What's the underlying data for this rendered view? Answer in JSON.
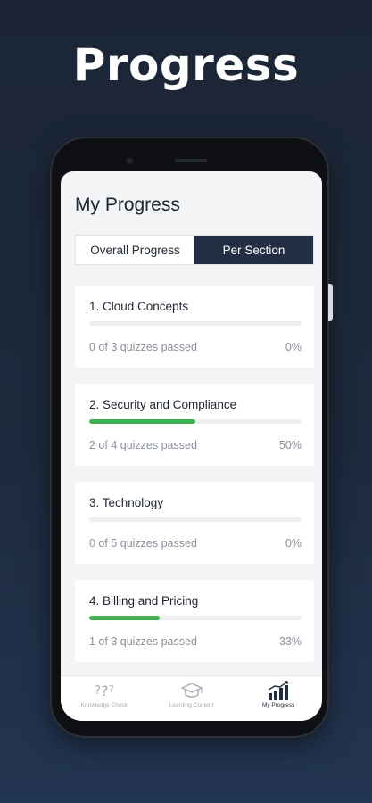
{
  "headline": "Progress",
  "screen": {
    "title": "My Progress",
    "segments": [
      {
        "label": "Overall Progress",
        "active": false
      },
      {
        "label": "Per Section",
        "active": true
      }
    ],
    "sections": [
      {
        "title": "1. Cloud Concepts",
        "summary": "0 of 3 quizzes passed",
        "percent_label": "0%",
        "progress": 0
      },
      {
        "title": "2. Security and Compliance",
        "summary": "2 of 4 quizzes passed",
        "percent_label": "50%",
        "progress": 0.5
      },
      {
        "title": "3. Technology",
        "summary": "0 of 5 quizzes passed",
        "percent_label": "0%",
        "progress": 0
      },
      {
        "title": "4.  Billing and Pricing",
        "summary": "1 of 3 quizzes passed",
        "percent_label": "33%",
        "progress": 0.33
      }
    ],
    "tabs": [
      {
        "label": "Knowledge Check",
        "icon": "question-marks-icon",
        "active": false
      },
      {
        "label": "Learning Content",
        "icon": "graduation-cap-icon",
        "active": false
      },
      {
        "label": "My Progress",
        "icon": "bar-chart-icon",
        "active": true
      }
    ]
  },
  "colors": {
    "accent_dark": "#232e42",
    "progress_fill": "#3db04f",
    "background": "#1d2a3d"
  }
}
